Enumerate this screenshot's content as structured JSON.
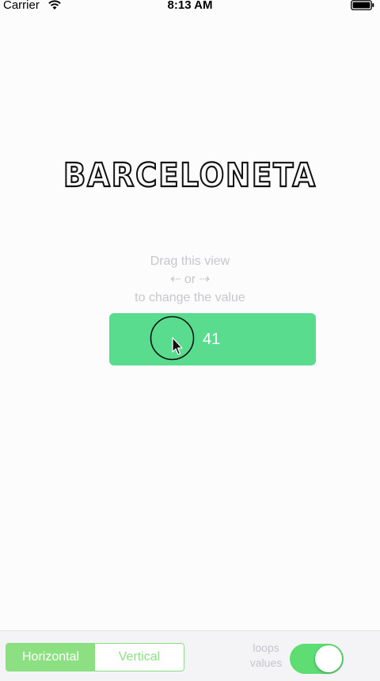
{
  "status_bar": {
    "carrier": "Carrier",
    "time": "8:13 AM",
    "wifi_icon": "wifi-icon",
    "battery_icon": "battery-icon"
  },
  "logo": {
    "text": "BARCELONETA"
  },
  "hint": {
    "line1": "Drag this view",
    "line2": "⇠ or ⇢",
    "line3": "to change the value"
  },
  "drag_view": {
    "value": "41",
    "color": "#59dc8d"
  },
  "bottom_bar": {
    "segments": [
      {
        "label": "Horizontal",
        "selected": true
      },
      {
        "label": "Vertical",
        "selected": false
      }
    ],
    "loops_label_line1": "loops",
    "loops_label_line2": "values",
    "toggle_on": true,
    "accent_color": "#8ce082",
    "toggle_color": "#5ddd72"
  }
}
